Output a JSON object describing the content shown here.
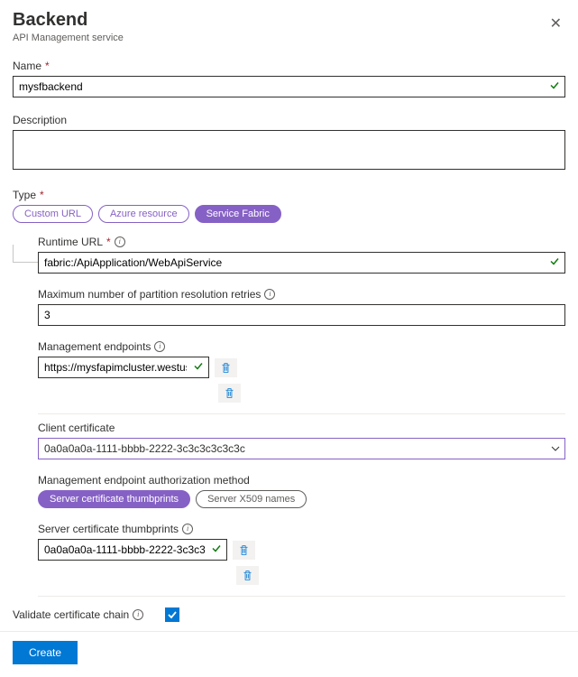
{
  "header": {
    "title": "Backend",
    "subtitle": "API Management service"
  },
  "name": {
    "label": "Name",
    "value": "mysfbackend"
  },
  "description": {
    "label": "Description",
    "value": ""
  },
  "type": {
    "label": "Type",
    "options": {
      "custom": "Custom URL",
      "azure": "Azure resource",
      "fabric": "Service Fabric"
    }
  },
  "fabric": {
    "runtime": {
      "label": "Runtime URL",
      "value": "fabric:/ApiApplication/WebApiService"
    },
    "retries": {
      "label": "Maximum number of partition resolution retries",
      "value": "3"
    },
    "mgmt": {
      "label": "Management endpoints",
      "entry": "https://mysfapimcluster.westus.cloud..."
    },
    "clientcert": {
      "label": "Client certificate",
      "value": "0a0a0a0a-1111-bbbb-2222-3c3c3c3c3c3c"
    },
    "authmethod": {
      "label": "Management endpoint authorization method",
      "options": {
        "thumb": "Server certificate thumbprints",
        "x509": "Server X509 names"
      }
    },
    "thumb": {
      "label": "Server certificate thumbprints",
      "entry": "0a0a0a0a-1111-bbbb-2222-3c3c3c..."
    },
    "validate": {
      "label": "Validate certificate chain"
    }
  },
  "footer": {
    "create": "Create"
  }
}
